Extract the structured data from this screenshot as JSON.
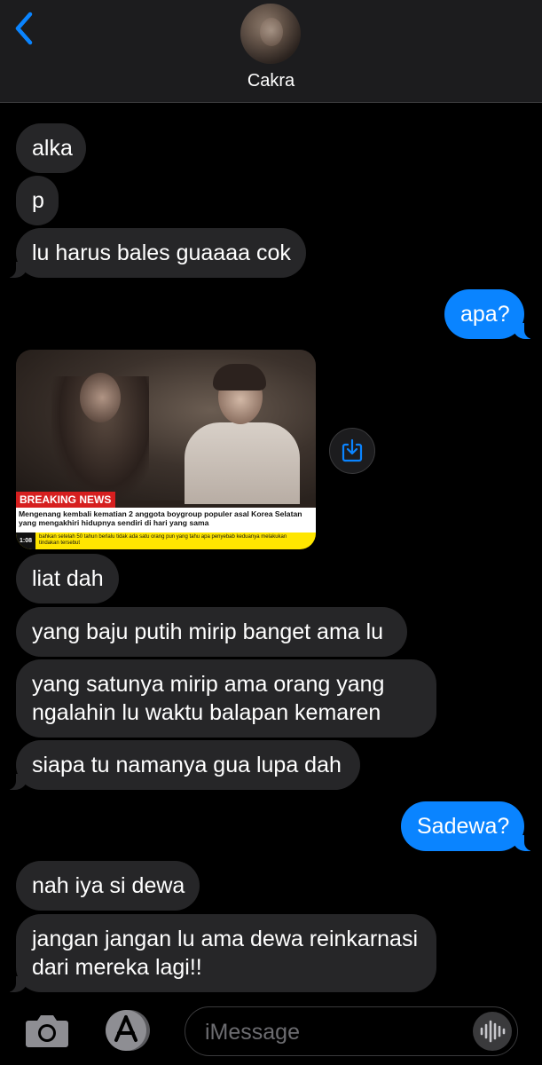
{
  "header": {
    "contact_name": "Cakra",
    "back_icon": "chevron-left-icon",
    "accent_color": "#0a84ff"
  },
  "messages": [
    {
      "direction": "incoming",
      "text": "alka"
    },
    {
      "direction": "incoming",
      "text": "p"
    },
    {
      "direction": "incoming",
      "text": "lu harus bales guaaaa cok"
    },
    {
      "direction": "outgoing",
      "text": "apa?"
    },
    {
      "direction": "incoming",
      "type": "image",
      "image": {
        "badge": "BREAKING NEWS",
        "headline": "Mengenang kembali kematian 2 anggota boygroup populer asal Korea Selatan yang mengakhiri hidupnya sendiri di hari yang sama",
        "ticker_time": "1:08",
        "ticker_text": "bahkan setelah 50 tahun berlalu tidak ada satu orang pun yang tahu apa penyebab keduanya melakukan tindakan tersebut"
      }
    },
    {
      "direction": "incoming",
      "text": "liat dah"
    },
    {
      "direction": "incoming",
      "text": "yang baju putih mirip banget ama lu"
    },
    {
      "direction": "incoming",
      "lines": [
        "yang satunya mirip ama orang yang",
        "ngalahin lu waktu balapan kemaren"
      ]
    },
    {
      "direction": "incoming",
      "text": "siapa tu namanya gua lupa dah"
    },
    {
      "direction": "outgoing",
      "text": "Sadewa?"
    },
    {
      "direction": "incoming",
      "text": "nah iya si dewa"
    },
    {
      "direction": "incoming",
      "lines": [
        "jangan jangan lu ama dewa reinkarnasi",
        "dari mereka lagi!!"
      ]
    }
  ],
  "composer": {
    "placeholder": "iMessage",
    "camera_icon": "camera-icon",
    "apps_icon": "app-store-icon",
    "audio_icon": "waveform-icon"
  },
  "colors": {
    "incoming_bubble": "#262628",
    "outgoing_bubble": "#0a84ff",
    "background": "#000000"
  }
}
